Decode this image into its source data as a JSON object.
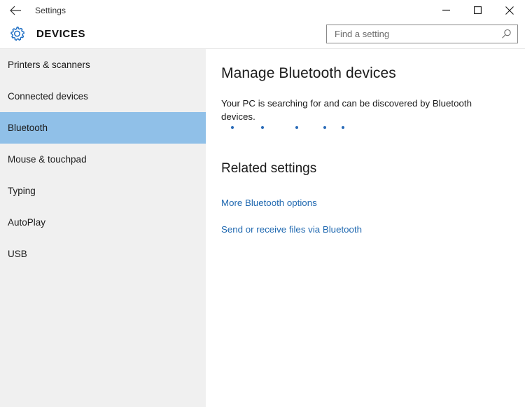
{
  "titlebar": {
    "back_icon": "back-arrow-icon",
    "title": "Settings",
    "minimize_label": "Minimize",
    "maximize_label": "Maximize",
    "close_label": "Close"
  },
  "header": {
    "gear_icon": "gear-icon",
    "app_title": "DEVICES"
  },
  "search": {
    "placeholder": "Find a setting",
    "value": "",
    "icon": "search-icon"
  },
  "sidebar": {
    "items": [
      {
        "label": "Printers & scanners",
        "selected": false
      },
      {
        "label": "Connected devices",
        "selected": false
      },
      {
        "label": "Bluetooth",
        "selected": true
      },
      {
        "label": "Mouse & touchpad",
        "selected": false
      },
      {
        "label": "Typing",
        "selected": false
      },
      {
        "label": "AutoPlay",
        "selected": false
      },
      {
        "label": "USB",
        "selected": false
      }
    ]
  },
  "main": {
    "page_title": "Manage Bluetooth devices",
    "status_text": "Your PC is searching for and can be discovered by Bluetooth devices.",
    "progress_dots": {
      "count": 5,
      "offsets": [
        14,
        57,
        106,
        146,
        172
      ],
      "color": "#2a6bb8"
    },
    "related_title": "Related settings",
    "links": [
      {
        "label": "More Bluetooth options"
      },
      {
        "label": "Send or receive files via Bluetooth"
      }
    ]
  },
  "colors": {
    "selection_blue": "#90c0e8",
    "link_blue": "#1f68b0",
    "sidebar_bg": "#f0f0f0",
    "accent_blue": "#2a6bb8"
  }
}
